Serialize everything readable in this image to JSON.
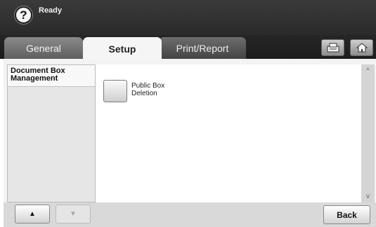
{
  "header": {
    "help_icon": "help-icon",
    "help_glyph": "?",
    "status": "Ready"
  },
  "tabs": [
    {
      "label": "General",
      "active": false
    },
    {
      "label": "Setup",
      "active": true
    },
    {
      "label": "Print/Report",
      "active": false
    }
  ],
  "toolbar_icons": [
    "copy-icon",
    "home-icon"
  ],
  "sidebar": {
    "items": [
      {
        "label": "Document Box Management",
        "selected": true
      }
    ]
  },
  "main": {
    "functions": [
      {
        "label": "Public Box Deletion"
      }
    ]
  },
  "scrollbar": {
    "up_glyph": "^",
    "down_glyph": "v"
  },
  "footer": {
    "up_glyph": "▲",
    "down_glyph": "▼",
    "back_label": "Back"
  }
}
